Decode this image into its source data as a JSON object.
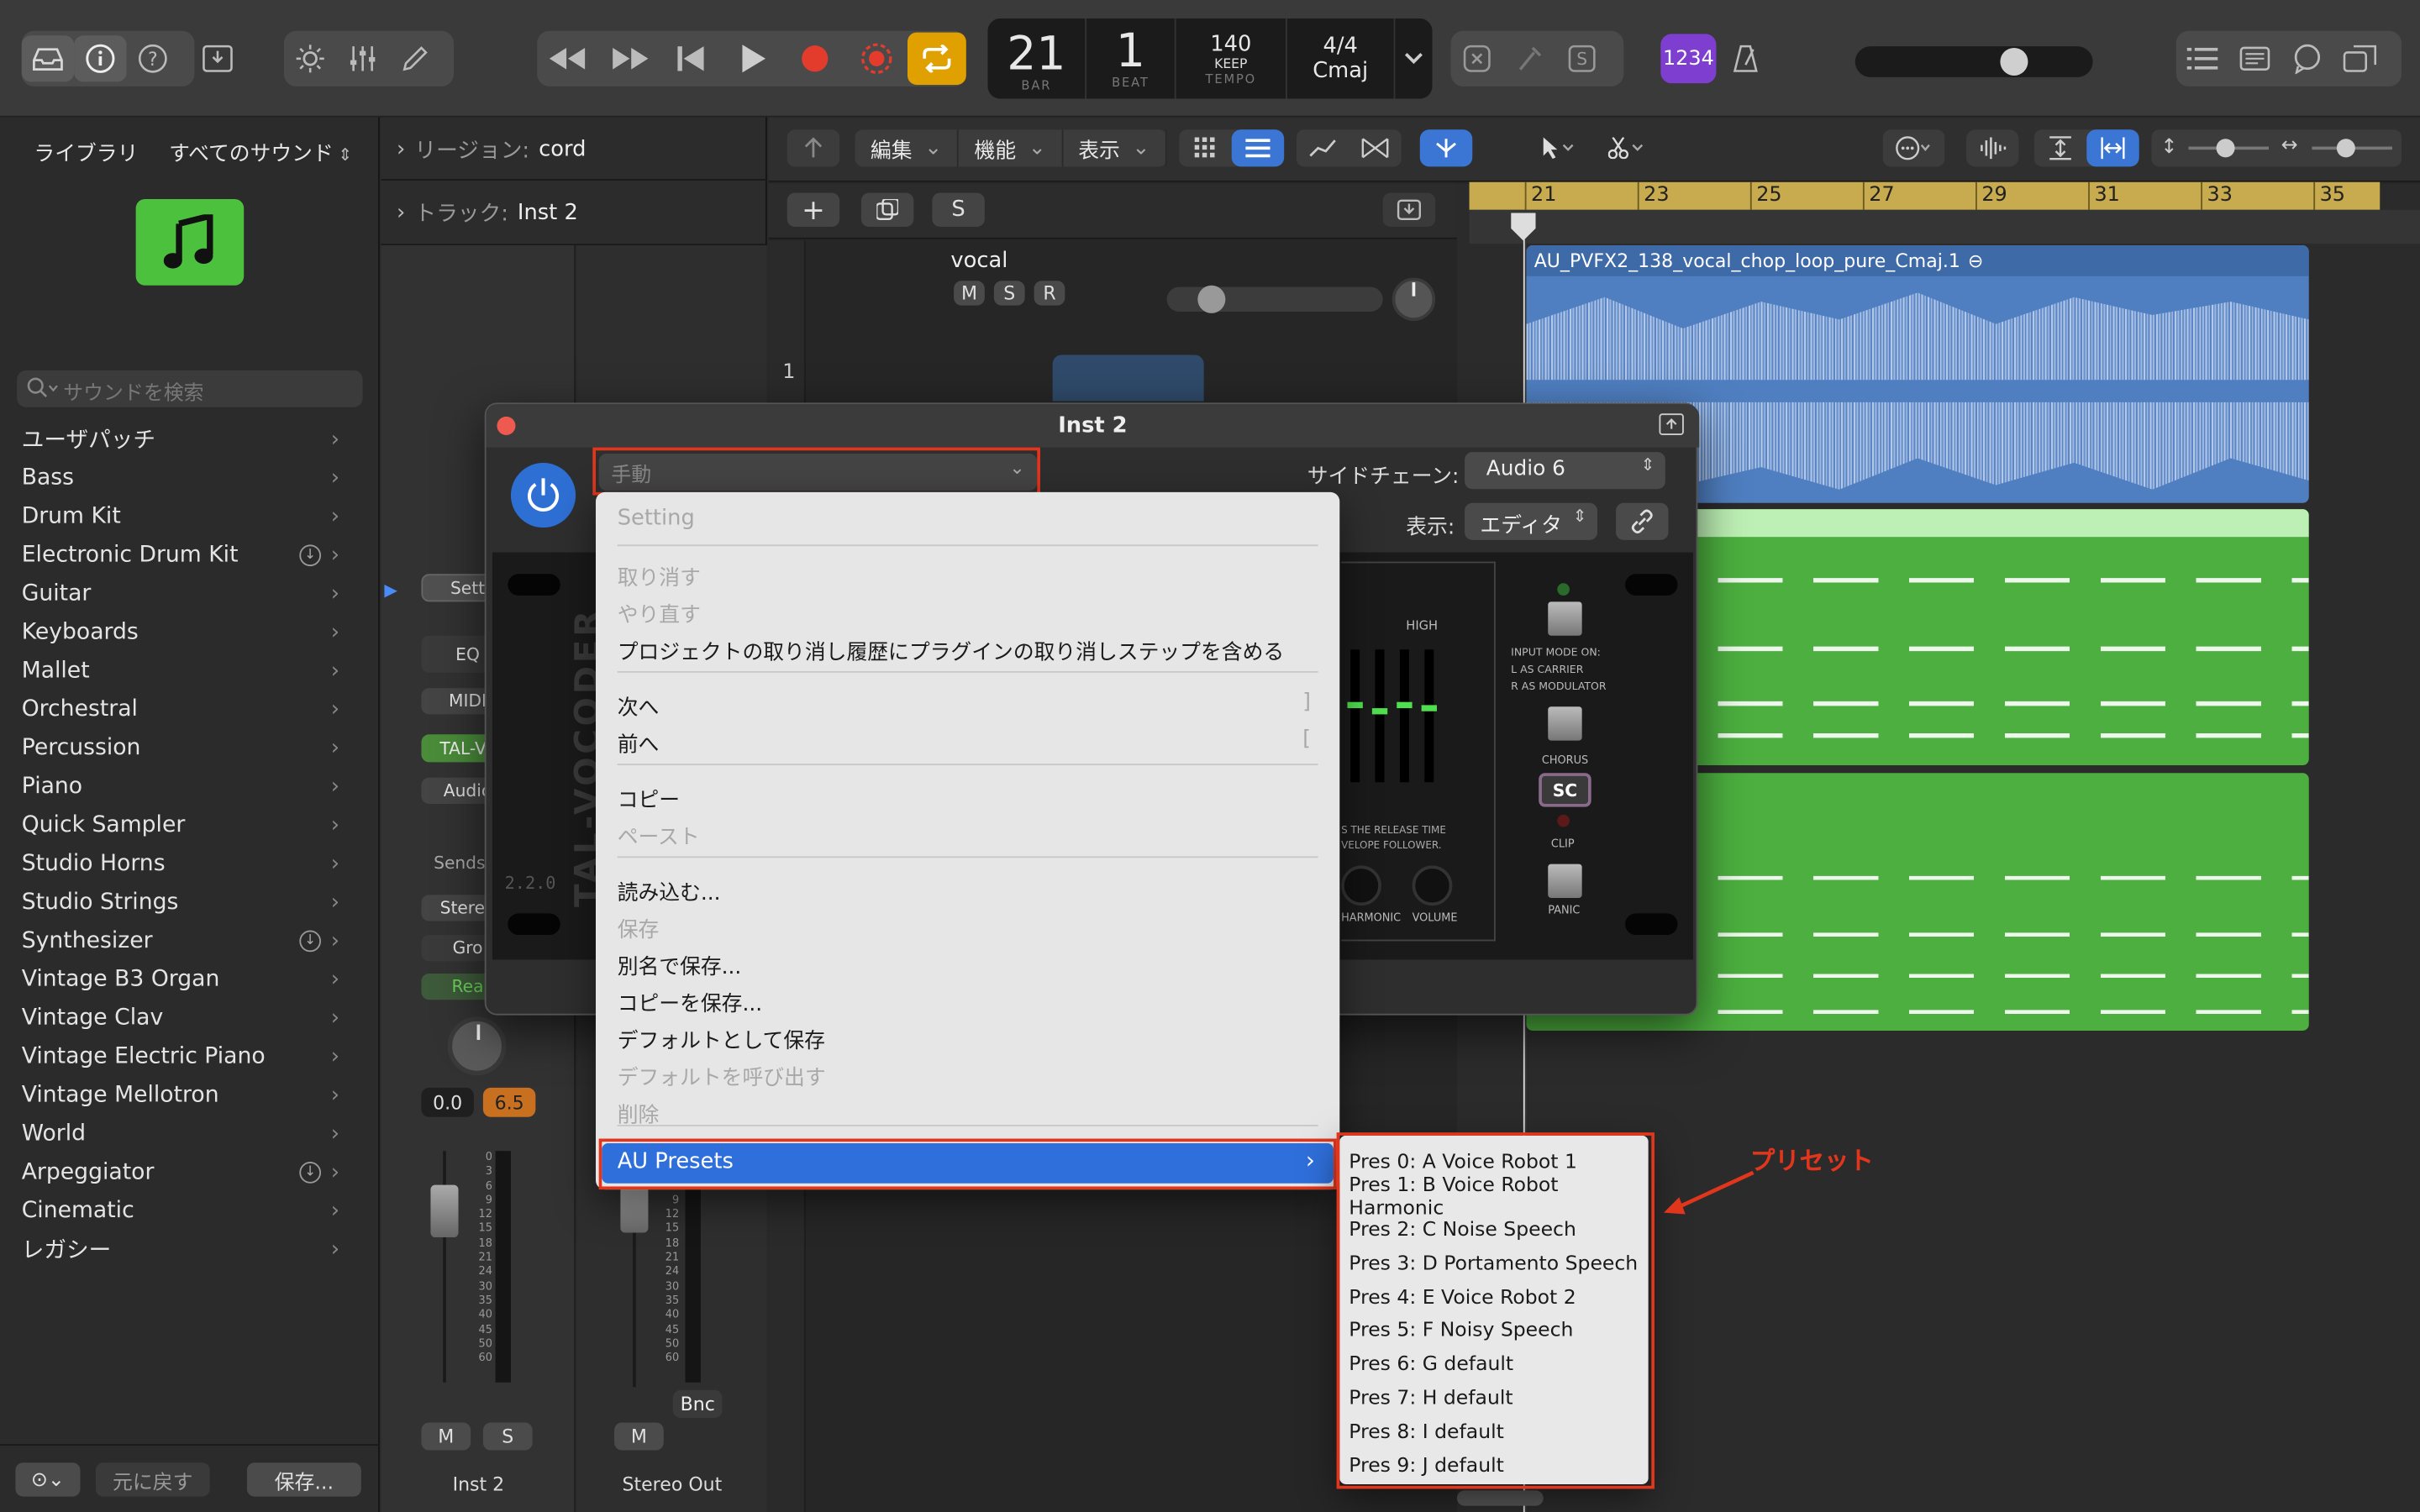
{
  "toolbar": {
    "transport": {
      "bar": "21",
      "beat": "1",
      "bar_label": "BAR",
      "beat_label": "BEAT",
      "tempo": "140",
      "tempo_mode": "KEEP",
      "tempo_label": "TEMPO",
      "time_sig": "4/4",
      "key": "Cmaj"
    },
    "counter_badge": "1234",
    "icons": [
      "inbox-icon",
      "info-icon",
      "help-icon",
      "download-icon",
      "brightness-icon",
      "mixer-icon",
      "pencil-icon",
      "rewind-icon",
      "fast-forward-icon",
      "skip-back-icon",
      "play-icon",
      "record-icon",
      "capture-record-icon",
      "cycle-icon",
      "close-box-icon",
      "tuner-icon",
      "solo-s-icon",
      "metronome-icon",
      "list-icon",
      "notes-icon",
      "chat-icon",
      "browser-icon"
    ]
  },
  "library": {
    "title": "ライブラリ",
    "sound_filter": "すべてのサウンド",
    "search_placeholder": "サウンドを検索",
    "items": [
      {
        "label": "ユーザパッチ",
        "download": false
      },
      {
        "label": "Bass",
        "download": false
      },
      {
        "label": "Drum Kit",
        "download": false
      },
      {
        "label": "Electronic Drum Kit",
        "download": true
      },
      {
        "label": "Guitar",
        "download": false
      },
      {
        "label": "Keyboards",
        "download": false
      },
      {
        "label": "Mallet",
        "download": false
      },
      {
        "label": "Orchestral",
        "download": false
      },
      {
        "label": "Percussion",
        "download": false
      },
      {
        "label": "Piano",
        "download": false
      },
      {
        "label": "Quick Sampler",
        "download": false
      },
      {
        "label": "Studio Horns",
        "download": false
      },
      {
        "label": "Studio Strings",
        "download": false
      },
      {
        "label": "Synthesizer",
        "download": true
      },
      {
        "label": "Vintage B3 Organ",
        "download": false
      },
      {
        "label": "Vintage Clav",
        "download": false
      },
      {
        "label": "Vintage Electric Piano",
        "download": false
      },
      {
        "label": "Vintage Mellotron",
        "download": false
      },
      {
        "label": "World",
        "download": false
      },
      {
        "label": "Arpeggiator",
        "download": true
      },
      {
        "label": "Cinematic",
        "download": false
      },
      {
        "label": "レガシー",
        "download": false
      }
    ],
    "revert_label": "元に戻す",
    "save_label": "保存..."
  },
  "inspector": {
    "region_label": "リージョン:",
    "region_value": "cord",
    "track_label": "トラック:",
    "track_value": "Inst 2",
    "strip1": {
      "setting": "Sett",
      "eq": "EQ",
      "midi": "MIDI",
      "plugin": "TAL-Vo",
      "audio": "Audio",
      "sends": "Sends",
      "stereo": "Stereo",
      "group": "Gro",
      "read": "Rea",
      "vol": "0.0",
      "pan": "6.5",
      "m": "M",
      "s": "S",
      "name": "Inst 2"
    },
    "strip2": {
      "bnc": "Bnc",
      "m": "M",
      "name": "Stereo Out"
    },
    "meter_scale": [
      "0",
      "3",
      "6",
      "9",
      "12",
      "15",
      "18",
      "21",
      "24",
      "30",
      "35",
      "40",
      "45",
      "50",
      "60"
    ]
  },
  "arrange": {
    "menus": [
      "編集",
      "機能",
      "表示"
    ],
    "s_button": "S",
    "track_name": "vocal",
    "track_number": "1",
    "track_buttons": [
      "M",
      "S",
      "R"
    ],
    "ruler": [
      "21",
      "23",
      "25",
      "27",
      "29",
      "31",
      "33",
      "35"
    ],
    "audio_region": "AU_PVFX2_138_vocal_chop_loop_pure_Cmaj.1"
  },
  "plugin": {
    "title": "Inst 2",
    "preset_value": "手動",
    "sidechain_label": "サイドチェーン:",
    "sidechain_value": "Audio 6",
    "view_label": "表示:",
    "view_value": "エディタ",
    "version": "2.2.0",
    "brand": "TAL-VOCODER",
    "labels": {
      "high": "HIGH",
      "input_mode": "INPUT MODE ON:",
      "carrier": "L  AS CARRIER",
      "modulator": "R  AS MODULATOR",
      "chorus": "CHORUS",
      "sc": "SC",
      "clip": "CLIP",
      "panic": "PANIC",
      "harmonic": "HARMONIC",
      "volume": "VOLUME",
      "release": "S THE RELEASE TIME",
      "envelope": "VELOPE FOLLOWER."
    }
  },
  "menu": {
    "header": "Setting",
    "items": [
      {
        "label": "取り消す",
        "disabled": true
      },
      {
        "label": "やり直す",
        "disabled": true
      },
      {
        "label": "プロジェクトの取り消し履歴にプラグインの取り消しステップを含める",
        "disabled": false
      },
      {
        "label": "次へ",
        "disabled": false,
        "shortcut": "]"
      },
      {
        "label": "前へ",
        "disabled": false,
        "shortcut": "["
      },
      {
        "label": "コピー",
        "disabled": false
      },
      {
        "label": "ペースト",
        "disabled": true
      },
      {
        "label": "読み込む...",
        "disabled": false
      },
      {
        "label": "保存",
        "disabled": true
      },
      {
        "label": "別名で保存...",
        "disabled": false
      },
      {
        "label": "コピーを保存...",
        "disabled": false
      },
      {
        "label": "デフォルトとして保存",
        "disabled": false
      },
      {
        "label": "デフォルトを呼び出す",
        "disabled": true
      },
      {
        "label": "削除",
        "disabled": true
      }
    ],
    "au_presets": "AU Presets"
  },
  "presets": [
    "Pres 0: A Voice Robot 1",
    "Pres 1: B Voice Robot Harmonic",
    "Pres 2: C Noise Speech",
    "Pres 3: D Portamento Speech",
    "Pres 4: E Voice Robot 2",
    "Pres 5: F Noisy Speech",
    "Pres 6: G default",
    "Pres 7: H default",
    "Pres 8: I default",
    "Pres 9: J default"
  ],
  "annotation": "プリセット",
  "colors": {
    "accent": "#2f6fdb",
    "highlight": "#e2361c",
    "region_audio": "#4f7fc1",
    "region_midi": "#4caf3f",
    "ruler": "#c8ab4e",
    "cycle": "#e0a000",
    "record": "#e43c2c"
  }
}
